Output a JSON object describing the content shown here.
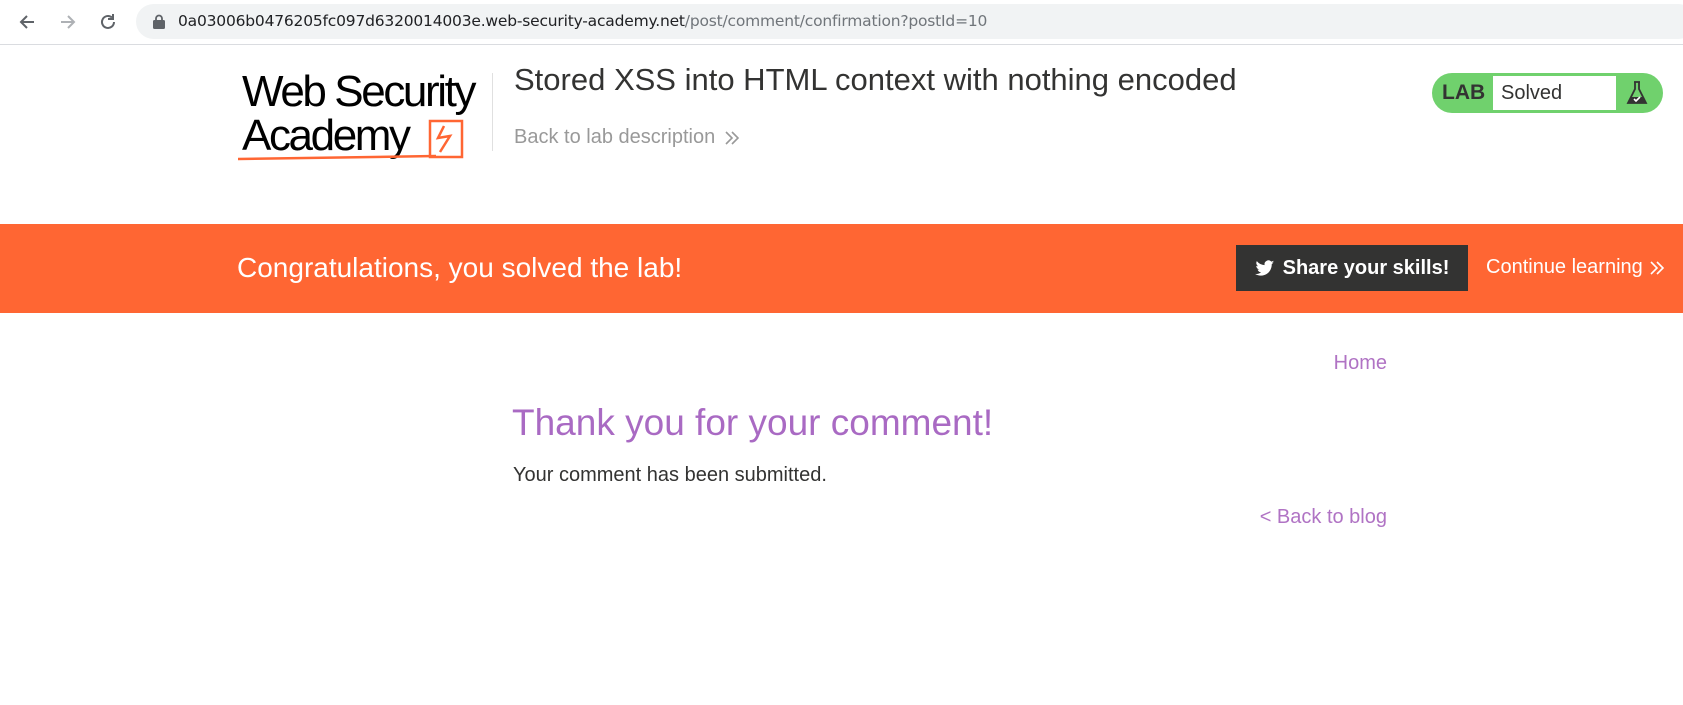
{
  "browser": {
    "url_host": "0a03006b0476205fc097d6320014003e.web-security-academy.net",
    "url_path": "/post/comment/confirmation?postId=10"
  },
  "header": {
    "logo_line1": "Web Security",
    "logo_line2": "Academy",
    "lab_title": "Stored XSS into HTML context with nothing encoded",
    "back_link": "Back to lab description",
    "status_prefix": "LAB",
    "status_text": "Solved"
  },
  "banner": {
    "message": "Congratulations, you solved the lab!",
    "share_label": "Share your skills!",
    "continue_label": "Continue learning"
  },
  "content": {
    "nav_home": "Home",
    "heading": "Thank you for your comment!",
    "message": "Your comment has been submitted.",
    "back_link": "< Back to blog"
  },
  "colors": {
    "brand_orange": "#ff6633",
    "solved_green": "#70d16d",
    "link_purple": "#b073c4",
    "text_dark": "#333332"
  },
  "icons": [
    "back-arrow-icon",
    "forward-arrow-icon",
    "reload-icon",
    "lock-icon",
    "chevron-right-icon",
    "flask-icon",
    "twitter-icon"
  ]
}
